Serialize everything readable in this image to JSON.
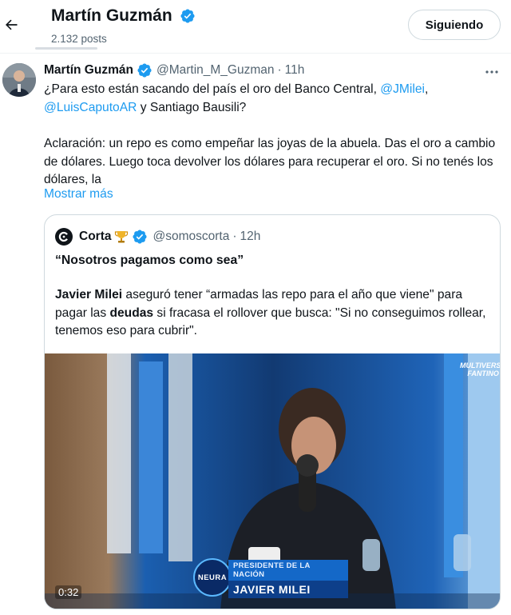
{
  "header": {
    "name": "Martín Guzmán",
    "posts": "2.132 posts",
    "follow_label": "Siguiendo"
  },
  "tweet": {
    "author_name": "Martín Guzmán",
    "author_handle": "@Martin_M_Guzman",
    "separator": "·",
    "time": "11h",
    "text_part1": "¿Para esto están sacando del país el oro del Banco Central, ",
    "mention1": "@JMilei",
    "text_part2": ", ",
    "mention2": "@LuisCaputoAR",
    "text_part3": " y Santiago Bausili?",
    "paragraph2": "Aclaración: un repo es como empeñar las joyas de la abuela. Das el oro a cambio de dólares. Luego toca devolver los dólares para recuperar el oro. Si no tenés los dólares, la",
    "show_more": "Mostrar más"
  },
  "quote": {
    "name": "Corta",
    "handle": "@somoscorta",
    "separator": "·",
    "time": "12h",
    "title": "“Nosotros pagamos como sea”",
    "body_bold1": "Javier Milei",
    "body_text1": " aseguró tener “armadas las repo para el año que viene\" para pagar las ",
    "body_bold2": "deudas",
    "body_text2": " si fracasa el rollover que busca: \"Si no conseguimos rollear, tenemos eso para cubrir\"."
  },
  "video": {
    "duration": "0:32",
    "lower_third_top": "PRESIDENTE DE LA NACIÓN",
    "lower_third_name": "JAVIER MILEI",
    "logo": "NEURA",
    "channel_line1": "MULTIVERSO",
    "channel_line2": "FANTINO"
  },
  "icons": {
    "back": "arrow-left-icon",
    "verified": "verified-badge-icon",
    "more": "more-options-icon",
    "trophy": "trophy-icon",
    "corta_logo": "corta-logo-icon"
  },
  "colors": {
    "link": "#1d9bf0",
    "muted": "#536471",
    "verified": "#1d9bf0"
  }
}
